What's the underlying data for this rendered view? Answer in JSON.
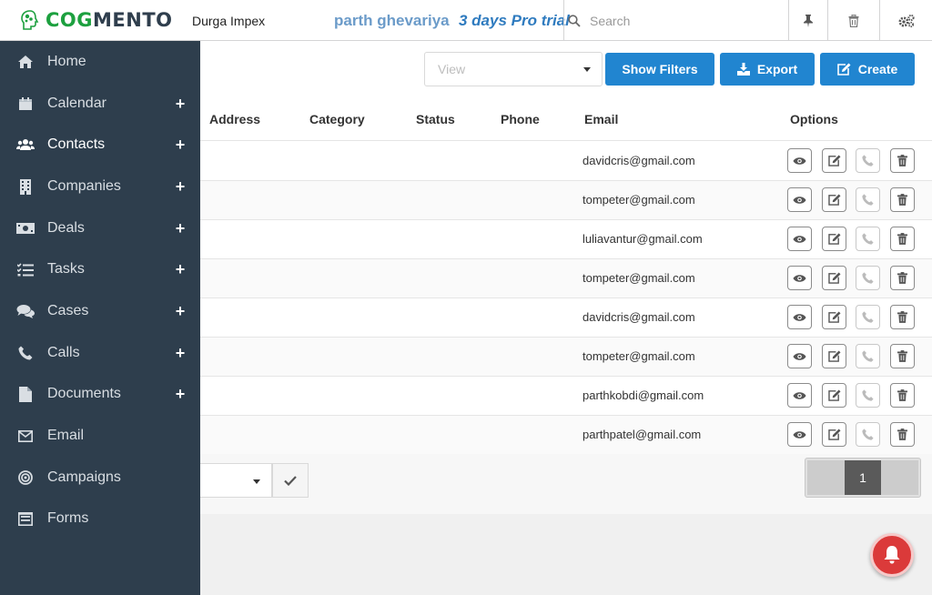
{
  "header": {
    "logo_text_1": "COG",
    "logo_text_2": "MENTO",
    "company": "Durga Impex",
    "user_name": "parth ghevariya",
    "trial": "3 days Pro trial",
    "search_placeholder": "Search"
  },
  "sidebar": {
    "items": [
      {
        "label": "Home",
        "icon": "home-icon",
        "has_add": false
      },
      {
        "label": "Calendar",
        "icon": "calendar-icon",
        "has_add": true
      },
      {
        "label": "Contacts",
        "icon": "users-icon",
        "has_add": true
      },
      {
        "label": "Companies",
        "icon": "building-icon",
        "has_add": true
      },
      {
        "label": "Deals",
        "icon": "money-icon",
        "has_add": true
      },
      {
        "label": "Tasks",
        "icon": "tasks-icon",
        "has_add": true
      },
      {
        "label": "Cases",
        "icon": "comments-icon",
        "has_add": true
      },
      {
        "label": "Calls",
        "icon": "phone-icon",
        "has_add": true
      },
      {
        "label": "Documents",
        "icon": "file-icon",
        "has_add": true
      },
      {
        "label": "Email",
        "icon": "envelope-icon",
        "has_add": false
      },
      {
        "label": "Campaigns",
        "icon": "bullseye-icon",
        "has_add": false
      },
      {
        "label": "Forms",
        "icon": "form-icon",
        "has_add": false
      }
    ],
    "add_symbol": "+"
  },
  "toolbar": {
    "view_placeholder": "View",
    "show_filters": "Show Filters",
    "export": "Export",
    "create": "Create"
  },
  "table": {
    "columns": [
      "Address",
      "Category",
      "Status",
      "Phone",
      "Email",
      "Options"
    ],
    "rows": [
      {
        "email": "davidcris@gmail.com"
      },
      {
        "email": "tompeter@gmail.com"
      },
      {
        "email": "luliavantur@gmail.com"
      },
      {
        "email": "tompeter@gmail.com"
      },
      {
        "email": "davidcris@gmail.com"
      },
      {
        "email": "tompeter@gmail.com"
      },
      {
        "email": "parthkobdi@gmail.com"
      },
      {
        "email": "parthpatel@gmail.com"
      }
    ]
  },
  "pagination": {
    "current_page": "1"
  },
  "colors": {
    "sidebar_bg": "#2e3e4d",
    "primary_button": "#2185d0",
    "logo_green": "#1da03f",
    "notification_red": "#db3a3a"
  }
}
